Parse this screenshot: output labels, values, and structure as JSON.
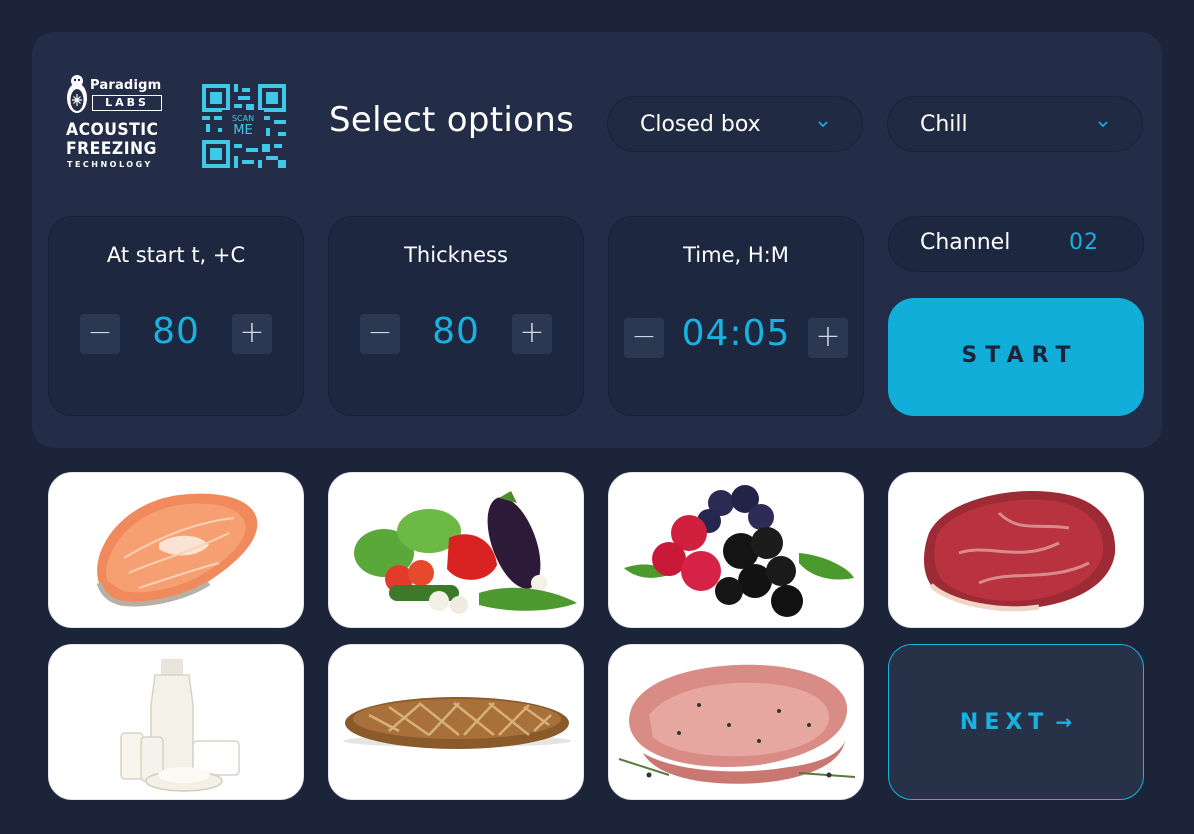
{
  "logo": {
    "brand": "Paradigm",
    "labs": "LABS",
    "line1": "ACOUSTIC",
    "line2": "FREEZING",
    "line3": "TECHNOLOGY"
  },
  "qr": {
    "scan": "SCAN",
    "me": "ME"
  },
  "header": {
    "title": "Select options"
  },
  "dropdowns": [
    {
      "value": "Closed box",
      "icon": "chevron-down-icon"
    },
    {
      "value": "Chill",
      "icon": "chevron-down-icon"
    }
  ],
  "controls": [
    {
      "label": "At start t, +C",
      "value": "80",
      "minus": "−",
      "plus": "+"
    },
    {
      "label": "Thickness",
      "value": "80",
      "minus": "−",
      "plus": "+"
    },
    {
      "label": "Time, H:M",
      "value": "04:05",
      "minus": "−",
      "plus": "+"
    }
  ],
  "channel": {
    "label": "Channel",
    "value": "02"
  },
  "start_label": "START",
  "products": [
    {
      "name": "salmon-steak"
    },
    {
      "name": "vegetables"
    },
    {
      "name": "berries"
    },
    {
      "name": "beef"
    },
    {
      "name": "dairy"
    },
    {
      "name": "bread"
    },
    {
      "name": "pork"
    }
  ],
  "next": {
    "label": "NEXT",
    "icon": "arrow-right-icon",
    "glyph": "→"
  },
  "colors": {
    "background": "#1b2438",
    "panel": "#232d48",
    "accent": "#10aed8",
    "card": "#1e2740"
  }
}
